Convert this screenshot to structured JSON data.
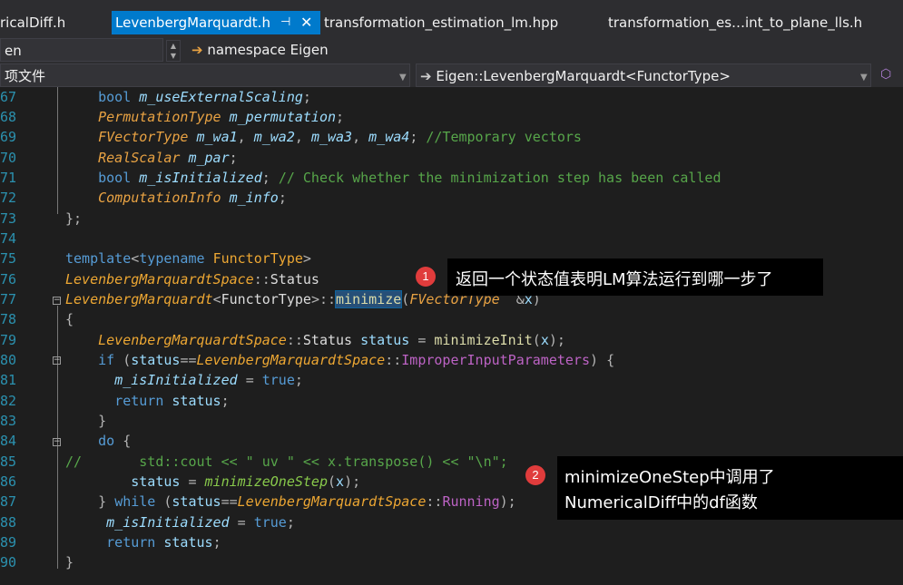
{
  "tabs": [
    {
      "label": "ricalDiff.h",
      "active": false
    },
    {
      "label": "LevenbergMarquardt.h",
      "active": true
    },
    {
      "label": "transformation_estimation_lm.hpp",
      "active": false
    },
    {
      "label": "transformation_es…int_to_plane_lls.h",
      "active": false
    }
  ],
  "nav": {
    "project": "en",
    "namespace": "namespace Eigen",
    "file_scope": "项文件",
    "member_scope": "Eigen::LevenbergMarquardt<FunctorType>"
  },
  "line_numbers": [
    "67",
    "68",
    "69",
    "70",
    "71",
    "72",
    "73",
    "74",
    "75",
    "76",
    "77",
    "78",
    "79",
    "80",
    "81",
    "82",
    "83",
    "84",
    "85",
    "86",
    "87",
    "88",
    "89",
    "90"
  ],
  "annotations": [
    {
      "badge": "1",
      "text": "返回一个状态值表明LM算法运行到哪一步了"
    },
    {
      "badge": "2",
      "line1": "minimizeOneStep中调用了",
      "line2": "NumericalDiff中的df函数"
    }
  ],
  "colors": {
    "accent": "#007acc",
    "badge": "#e03c3c",
    "background": "#1e1e1e"
  }
}
